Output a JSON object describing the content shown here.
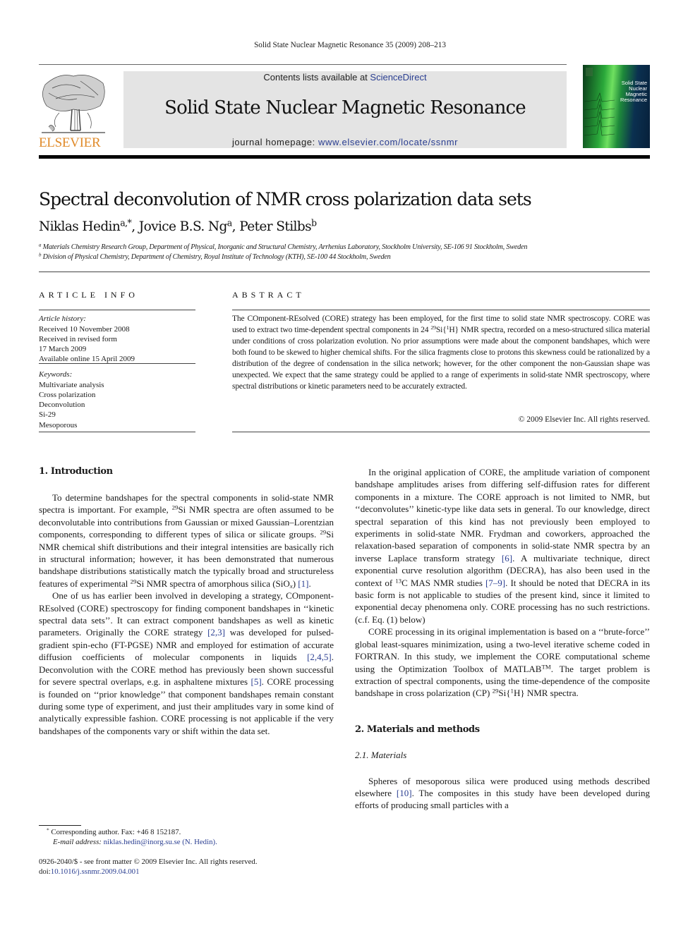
{
  "running_head": "Solid State Nuclear Magnetic Resonance 35 (2009) 208–213",
  "header": {
    "publisher_wordmark": "ELSEVIER",
    "contents_prefix": "Contents lists available at ",
    "contents_link": "ScienceDirect",
    "journal_title": "Solid State Nuclear Magnetic Resonance",
    "homepage_prefix": "journal homepage: ",
    "homepage_link": "www.elsevier.com/locate/ssnmr",
    "cover_title_lines": [
      "Solid State",
      "Nuclear",
      "Magnetic",
      "Resonance"
    ],
    "colors": {
      "publisher_orange": "#e08b2b",
      "link_blue": "#2a3e91",
      "banner_gray": "#e4e4e4"
    }
  },
  "article": {
    "title": "Spectral deconvolution of NMR cross polarization data sets",
    "authors": [
      {
        "name": "Niklas Hedin",
        "marks": "a,*"
      },
      {
        "name": "Jovice B.S. Ng",
        "marks": "a"
      },
      {
        "name": "Peter Stilbs",
        "marks": "b"
      }
    ],
    "affiliations": [
      {
        "mark": "a",
        "text": "Materials Chemistry Research Group, Department of Physical, Inorganic and Structural Chemistry, Arrhenius Laboratory, Stockholm University, SE-106 91 Stockholm, Sweden"
      },
      {
        "mark": "b",
        "text": "Division of Physical Chemistry, Department of Chemistry, Royal Institute of Technology (KTH), SE-100 44 Stockholm, Sweden"
      }
    ]
  },
  "article_info": {
    "heading": "ARTICLE INFO",
    "history_label": "Article history:",
    "history": [
      "Received 10 November 2008",
      "Received in revised form",
      "17 March 2009",
      "Available online 15 April 2009"
    ],
    "keywords_label": "Keywords:",
    "keywords": [
      "Multivariate analysis",
      "Cross polarization",
      "Deconvolution",
      "Si-29",
      "Mesoporous"
    ]
  },
  "abstract": {
    "heading": "ABSTRACT",
    "p1": "The COmponent-REsolved (CORE) strategy has been employed, for the first time to solid state NMR spectroscopy. CORE was used to extract two time-dependent spectral components in 24 ",
    "sup1": "29",
    "p2": "Si{",
    "sup2": "1",
    "p3": "H} NMR spectra, recorded on a meso-structured silica material under conditions of cross polarization evolution. No prior assumptions were made about the component bandshapes, which were both found to be skewed to higher chemical shifts. For the silica fragments close to protons this skewness could be rationalized by a distribution of the degree of condensation in the silica network; however, for the other component the non-Gaussian shape was unexpected. We expect that the same strategy could be applied to a range of experiments in solid-state NMR spectroscopy, where spectral distributions or kinetic parameters need to be accurately extracted.",
    "copyright": "© 2009 Elsevier Inc. All rights reserved."
  },
  "intro": {
    "heading": "1.  Introduction",
    "para1": {
      "a": "To determine bandshapes for the spectral components in solid-state NMR spectra is important. For example, ",
      "s1": "29",
      "b": "Si NMR spectra are often assumed to be deconvolutable into contributions from Gaussian or mixed Gaussian–Lorentzian components, corresponding to different types of silica or silicate groups. ",
      "s2": "29",
      "c": "Si NMR chemical shift distributions and their integral intensities are basically rich in structural information; however, it has been demonstrated that numerous bandshape distributions statistically match the typically broad and structureless features of experimental ",
      "s3": "29",
      "d": "Si NMR spectra of amorphous silica (SiO",
      "sub": "x",
      "e": ") ",
      "ref": "[1]",
      "f": "."
    },
    "para2": {
      "a": "One of us has earlier been involved in developing a strategy, COmponent-REsolved (CORE) spectroscopy for finding component bandshapes in ‘‘kinetic spectral data sets’’. It can extract component bandshapes as well as kinetic parameters. Originally the CORE strategy ",
      "ref1": "[2,3]",
      "b": " was developed for pulsed-gradient spin-echo (FT-PGSE) NMR and employed for estimation of accurate diffusion coefficients of molecular components in liquids ",
      "ref2": "[2,4,5]",
      "c": ". Deconvolution with the CORE method has previously been shown successful for severe spectral overlaps, e.g. in asphaltene mixtures ",
      "ref3": "[5]",
      "d": ". CORE processing is founded on ‘‘prior knowledge’’ that component bandshapes remain constant during some type of experiment, and just their amplitudes vary in some kind of analytically expressible fashion. CORE processing is not applicable if the very bandshapes of the components vary or shift within the data set."
    },
    "para3": {
      "a": "In the original application of CORE, the amplitude variation of component bandshape amplitudes arises from differing self-diffusion rates for different components in a mixture. The CORE approach is not limited to NMR, but ‘‘deconvolutes’’ kinetic-type like data sets in general. To our knowledge, direct spectral separation of this kind has not previously been employed to experiments in solid-state NMR. Frydman and coworkers, approached the relaxation-based separation of components in solid-state NMR spectra by an inverse Laplace transform strategy ",
      "ref1": "[6]",
      "b": ". A multivariate technique, direct exponential curve resolution algorithm (DECRA), has also been used in the context of ",
      "s1": "13",
      "c": "C MAS NMR studies ",
      "ref2": "[7–9]",
      "d": ". It should be noted that DECRA in its basic form is not applicable to studies of the present kind, since it limited to exponential decay phenomena only. CORE processing has no such restrictions. (c.f. Eq. (1) below)"
    },
    "para4": {
      "a": "CORE processing in its original implementation is based on a ‘‘brute-force’’ global least-squares minimization, using a two-level iterative scheme coded in FORTRAN. In this study, we implement the CORE computational scheme using the Optimization Toolbox of MATLAB",
      "tm": "TM",
      "b": ". The target problem is extraction of spectral components, using the time-dependence of the composite bandshape in cross polarization (CP) ",
      "s1": "29",
      "c": "Si{",
      "s2": "1",
      "d": "H} NMR spectra."
    }
  },
  "methods": {
    "heading": "2.  Materials and methods",
    "subheading": "2.1.  Materials",
    "para1": {
      "a": "Spheres of mesoporous silica were produced using methods described elsewhere ",
      "ref": "[10]",
      "b": ". The composites in this study have been developed during efforts of producing small particles with a"
    }
  },
  "footnotes": {
    "corresponding_mark": "*",
    "corresponding": " Corresponding author. Fax: +46 8 152187.",
    "email_label": "E-mail address: ",
    "email": "niklas.hedin@inorg.su.se",
    "email_suffix": " (N. Hedin).",
    "front_matter": "0926-2040/$ - see front matter © 2009 Elsevier Inc. All rights reserved.",
    "doi_label": "doi:",
    "doi": "10.1016/j.ssnmr.2009.04.001"
  }
}
